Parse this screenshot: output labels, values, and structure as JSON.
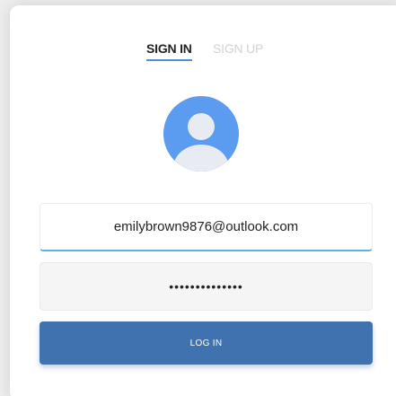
{
  "tabs": {
    "sign_in": "SIGN IN",
    "sign_up": "SIGN UP",
    "active": "sign_in"
  },
  "avatar": {
    "icon": "user-avatar-icon",
    "background_color": "#5b9bf0"
  },
  "form": {
    "email_value": "emilybrown9876@outlook.com",
    "password_masked": "••••••••••••••",
    "login_label": "LOG IN"
  },
  "colors": {
    "accent": "#4a90d9",
    "button": "#3f72ae",
    "input_focus": "#5ab0ec"
  }
}
